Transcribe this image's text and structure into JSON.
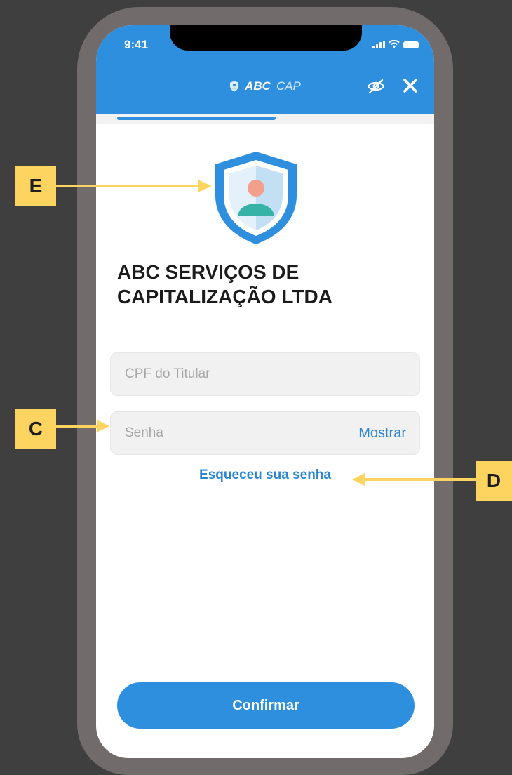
{
  "status_bar": {
    "time": "9:41"
  },
  "header": {
    "brand_bold": "ABC",
    "brand_light": "CAP",
    "show_password_icon": "eye-off-icon",
    "close_icon": "close-icon"
  },
  "progress": {
    "value": 0.5
  },
  "logo": {
    "icon": "shield-user-icon"
  },
  "org_name": "ABC SERVIÇOS DE CAPITALIZAÇÃO LTDA",
  "form": {
    "cpf_placeholder": "CPF do Titular",
    "password_placeholder": "Senha",
    "show_label": "Mostrar",
    "forgot_label": "Esqueceu sua senha"
  },
  "confirm_label": "Confirmar",
  "callouts": {
    "e": "E",
    "c": "C",
    "d": "D"
  },
  "colors": {
    "primary": "#2e8fdf",
    "callout": "#fcd45f",
    "background": "#3f3f3f",
    "frame": "#716c6b"
  }
}
